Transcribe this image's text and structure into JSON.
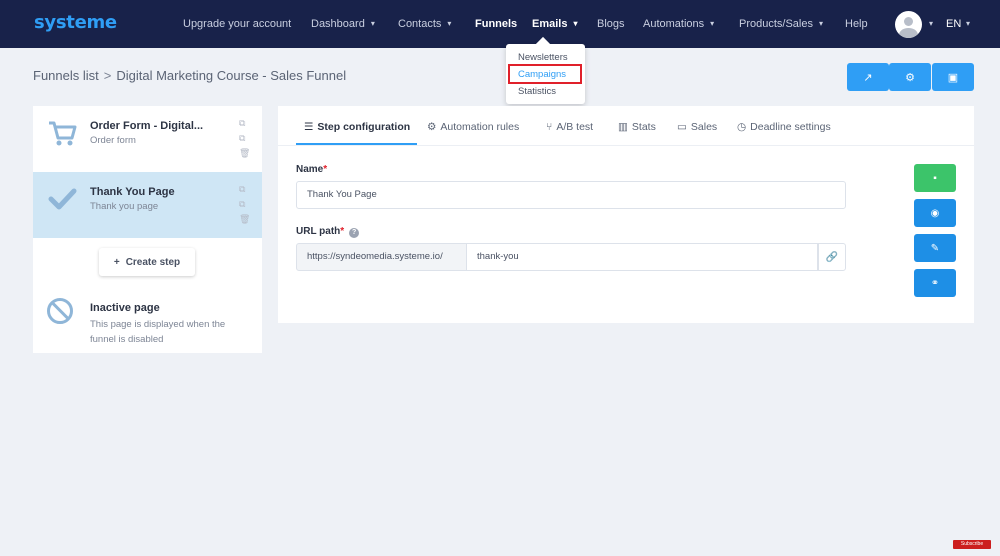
{
  "nav": {
    "logo": "systeme",
    "items": [
      {
        "label": "Upgrade your account",
        "caret": false,
        "active": false
      },
      {
        "label": "Dashboard",
        "caret": true,
        "active": false
      },
      {
        "label": "Contacts",
        "caret": true,
        "active": false
      },
      {
        "label": "Funnels",
        "caret": false,
        "active": true
      },
      {
        "label": "Emails",
        "caret": true,
        "active": false
      },
      {
        "label": "Blogs",
        "caret": false,
        "active": false
      },
      {
        "label": "Automations",
        "caret": true,
        "active": false
      },
      {
        "label": "Products/Sales",
        "caret": true,
        "active": false
      },
      {
        "label": "Help",
        "caret": false,
        "active": false
      }
    ],
    "language": "EN",
    "avatar_icon": "user-avatar-icon",
    "caret_glyph": "▾"
  },
  "emails_dropdown": {
    "items": [
      "Newsletters",
      "Campaigns",
      "Statistics"
    ],
    "highlighted": "Campaigns"
  },
  "breadcrumb": {
    "parent": "Funnels list",
    "separator": ">",
    "current": "Digital Marketing Course - Sales Funnel"
  },
  "header_actions": [
    {
      "icon": "external-link-icon",
      "glyph": "↗"
    },
    {
      "icon": "settings-icon",
      "glyph": "⚙"
    },
    {
      "icon": "shopping-bag-icon",
      "glyph": "▣"
    }
  ],
  "steps": [
    {
      "title": "Order Form - Digital...",
      "subtitle": "Order form",
      "icon": "cart-icon",
      "selected": false
    },
    {
      "title": "Thank You Page",
      "subtitle": "Thank you page",
      "icon": "checkmark-icon",
      "selected": true
    }
  ],
  "create_step_label": "Create step",
  "create_step_glyph": "+",
  "inactive_page": {
    "title": "Inactive page",
    "description": "This page is displayed when the funnel is disabled"
  },
  "tabs": [
    {
      "label": "Step configuration",
      "icon": "list-icon",
      "glyph": "☰",
      "active": true
    },
    {
      "label": "Automation rules",
      "icon": "gears-icon",
      "glyph": "⚙",
      "active": false
    },
    {
      "label": "A/B test",
      "icon": "split-icon",
      "glyph": "⑂",
      "active": false
    },
    {
      "label": "Stats",
      "icon": "bar-chart-icon",
      "glyph": "▥",
      "active": false
    },
    {
      "label": "Sales",
      "icon": "money-icon",
      "glyph": "▭",
      "active": false
    },
    {
      "label": "Deadline settings",
      "icon": "clock-icon",
      "glyph": "◷",
      "active": false
    }
  ],
  "form": {
    "name_label": "Name",
    "required_mark": "*",
    "name_value": "Thank You Page",
    "url_label": "URL path",
    "help_glyph": "?",
    "url_prefix": "https://syndeomedia.systeme.io/",
    "url_value": "thank-you",
    "link_glyph": "🔗"
  },
  "side_actions": [
    {
      "icon": "save-icon",
      "glyph": "▪",
      "color": "#3cc46a"
    },
    {
      "icon": "eye-icon",
      "glyph": "◉",
      "color": "#1e8fe6"
    },
    {
      "icon": "magic-wand-icon",
      "glyph": "✎",
      "color": "#1e8fe6"
    },
    {
      "icon": "link-icon",
      "glyph": "⚭",
      "color": "#1e8fe6"
    }
  ],
  "youtube_badge": "Subscribe",
  "colors": {
    "nav_bg": "#18224a",
    "accent": "#2f9ef5",
    "selected_step": "#cfe6f5",
    "highlight_box": "#e0202a"
  }
}
